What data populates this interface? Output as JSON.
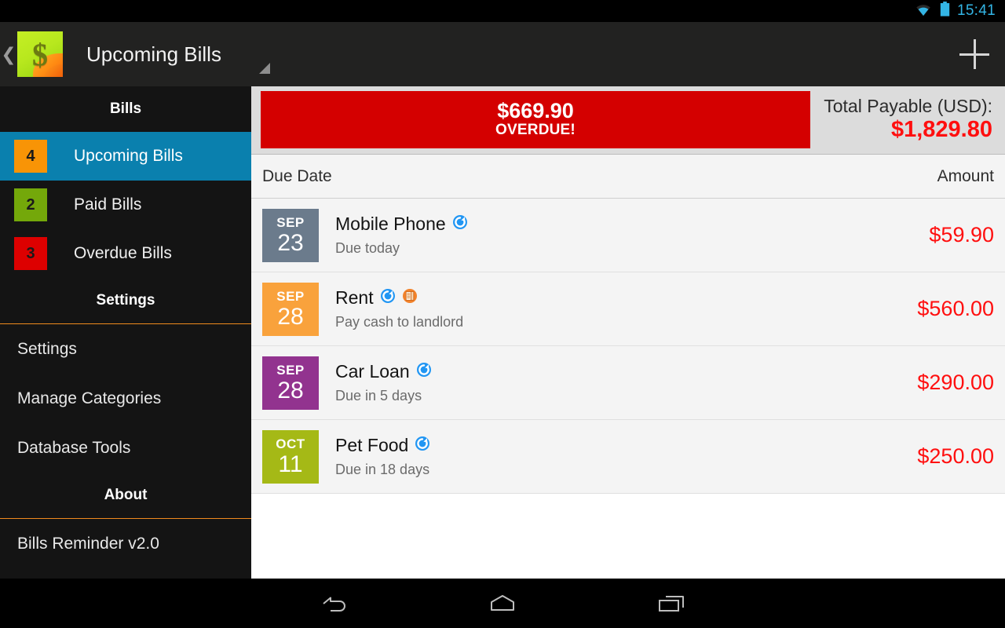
{
  "statusbar": {
    "time": "15:41",
    "wifi_icon": "wifi-icon",
    "battery_icon": "battery-icon",
    "accent_color": "#33b5e5"
  },
  "actionbar": {
    "back_icon": "back-chevron-icon",
    "app_icon": "app-logo-icon",
    "app_icon_glyph": "$",
    "title": "Upcoming Bills",
    "add_icon": "plus-icon",
    "drag_handle_icon": "resize-handle-icon",
    "background_color": "#222221"
  },
  "sidebar": {
    "sections": [
      {
        "header": "Bills"
      },
      {
        "header": "Settings"
      },
      {
        "header": "About"
      }
    ],
    "bills_header": "Bills",
    "settings_header": "Settings",
    "about_header": "About",
    "bill_items": [
      {
        "count": "4",
        "label": "Upcoming Bills",
        "badge_color": "#f89406",
        "selected": true
      },
      {
        "count": "2",
        "label": "Paid Bills",
        "badge_color": "#74a80a",
        "selected": false
      },
      {
        "count": "3",
        "label": "Overdue Bills",
        "badge_color": "#dd0000",
        "selected": false
      }
    ],
    "settings_items": [
      {
        "label": "Settings"
      },
      {
        "label": "Manage Categories"
      },
      {
        "label": "Database Tools"
      }
    ],
    "about_items": [
      {
        "label": "Bills Reminder v2.0"
      }
    ],
    "selected_color": "#0a80ae",
    "rule_color": "#f08a1e"
  },
  "totals": {
    "overdue_amount": "$669.90",
    "overdue_label": "OVERDUE!",
    "overdue_color": "#d40000",
    "total_label": "Total Payable (USD):",
    "total_amount": "$1,829.80",
    "total_amount_color": "#ff0f0f"
  },
  "list": {
    "col_date": "Due Date",
    "col_amount": "Amount",
    "rows": [
      {
        "month": "SEP",
        "day": "23",
        "chip_color": "#6b7b8c",
        "title": "Mobile Phone",
        "subtitle": "Due today",
        "amount": "$59.90",
        "icons": [
          "recurring-icon"
        ]
      },
      {
        "month": "SEP",
        "day": "28",
        "chip_color": "#f9a23c",
        "title": "Rent",
        "subtitle": "Pay cash to landlord",
        "amount": "$560.00",
        "icons": [
          "recurring-icon",
          "note-icon"
        ]
      },
      {
        "month": "SEP",
        "day": "28",
        "chip_color": "#92338f",
        "title": "Car Loan",
        "subtitle": "Due in 5 days",
        "amount": "$290.00",
        "icons": [
          "recurring-icon"
        ]
      },
      {
        "month": "OCT",
        "day": "11",
        "chip_color": "#a5b916",
        "title": "Pet Food",
        "subtitle": "Due in 18 days",
        "amount": "$250.00",
        "icons": [
          "recurring-icon"
        ]
      }
    ]
  },
  "navbar": {
    "back": "back-nav-icon",
    "home": "home-nav-icon",
    "recents": "recent-apps-nav-icon"
  }
}
